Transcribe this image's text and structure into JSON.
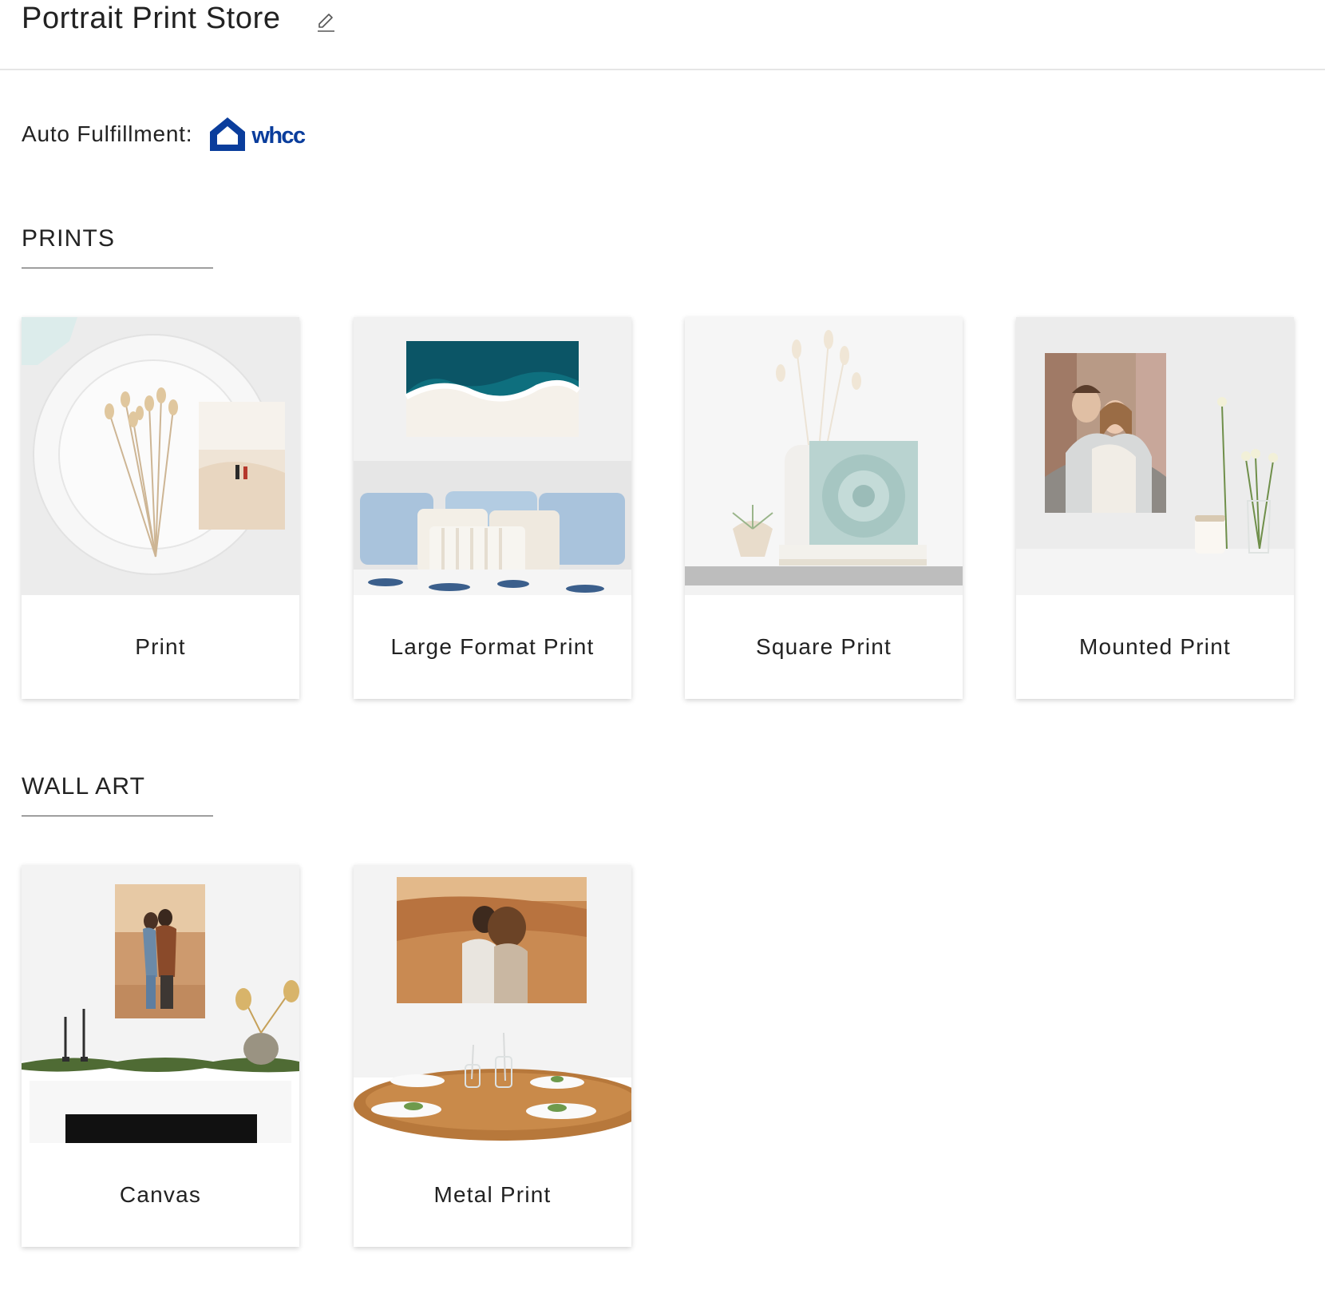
{
  "header": {
    "title": "Portrait Print Store",
    "edit_icon": "pencil-icon"
  },
  "fulfillment": {
    "label": "Auto Fulfillment:",
    "logo_text": "whcc",
    "logo_icon": "house-icon",
    "logo_color": "#0a3d9c"
  },
  "sections": [
    {
      "heading": "PRINTS",
      "products": [
        {
          "label": "Print"
        },
        {
          "label": "Large Format Print"
        },
        {
          "label": "Square Print"
        },
        {
          "label": "Mounted Print"
        }
      ]
    },
    {
      "heading": "WALL ART",
      "products": [
        {
          "label": "Canvas"
        },
        {
          "label": "Metal Print"
        }
      ]
    }
  ]
}
